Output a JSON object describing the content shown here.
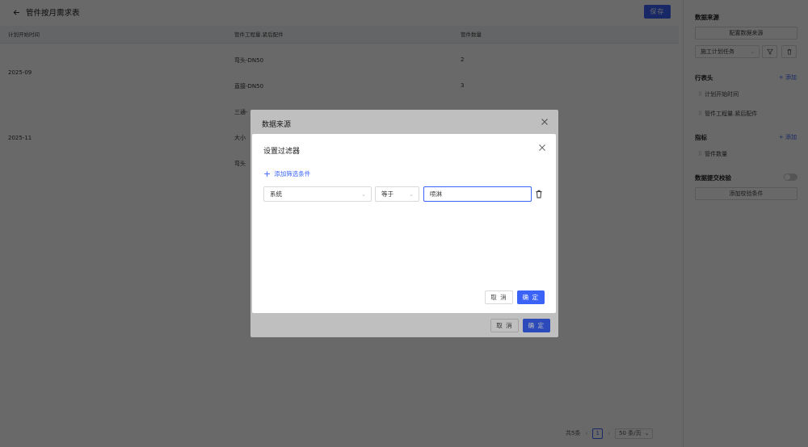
{
  "page": {
    "title": "管件按月需求表",
    "save_label": "保存"
  },
  "table": {
    "headers": [
      "计划开始时间",
      "管件工程量.紧后配件",
      "管件数量"
    ],
    "groups": [
      "2025-09",
      "2025-11"
    ],
    "rows": [
      {
        "part": "弯头-DN50",
        "qty": "2"
      },
      {
        "part": "直接-DN50",
        "qty": "3"
      },
      {
        "part": "三通-",
        "qty": ""
      },
      {
        "part": "大小",
        "qty": ""
      },
      {
        "part": "弯头",
        "qty": ""
      }
    ]
  },
  "pager": {
    "total": "共5条",
    "page": "1",
    "size": "50 条/页"
  },
  "side": {
    "datasource_title": "数据来源",
    "config_btn": "配置数据来源",
    "source_select": "施工计划任务",
    "row_header_title": "行表头",
    "add_label": "添加",
    "row_items": [
      "计划开始时间",
      "管件工程量.紧后配件"
    ],
    "metric_title": "指标",
    "metric_items": [
      "管件数量"
    ],
    "validation_title": "数据提交校验",
    "validation_btn": "添加校验条件"
  },
  "outer_modal": {
    "title": "数据来源",
    "cancel": "取 消",
    "ok": "确 定"
  },
  "inner_modal": {
    "title": "设置过滤器",
    "add_filter": "添加筛选条件",
    "filter_field": "系统",
    "filter_op": "等于",
    "filter_value": "喷淋",
    "cancel": "取 消",
    "ok": "确 定"
  },
  "colors": {
    "primary": "#3b63f7"
  }
}
